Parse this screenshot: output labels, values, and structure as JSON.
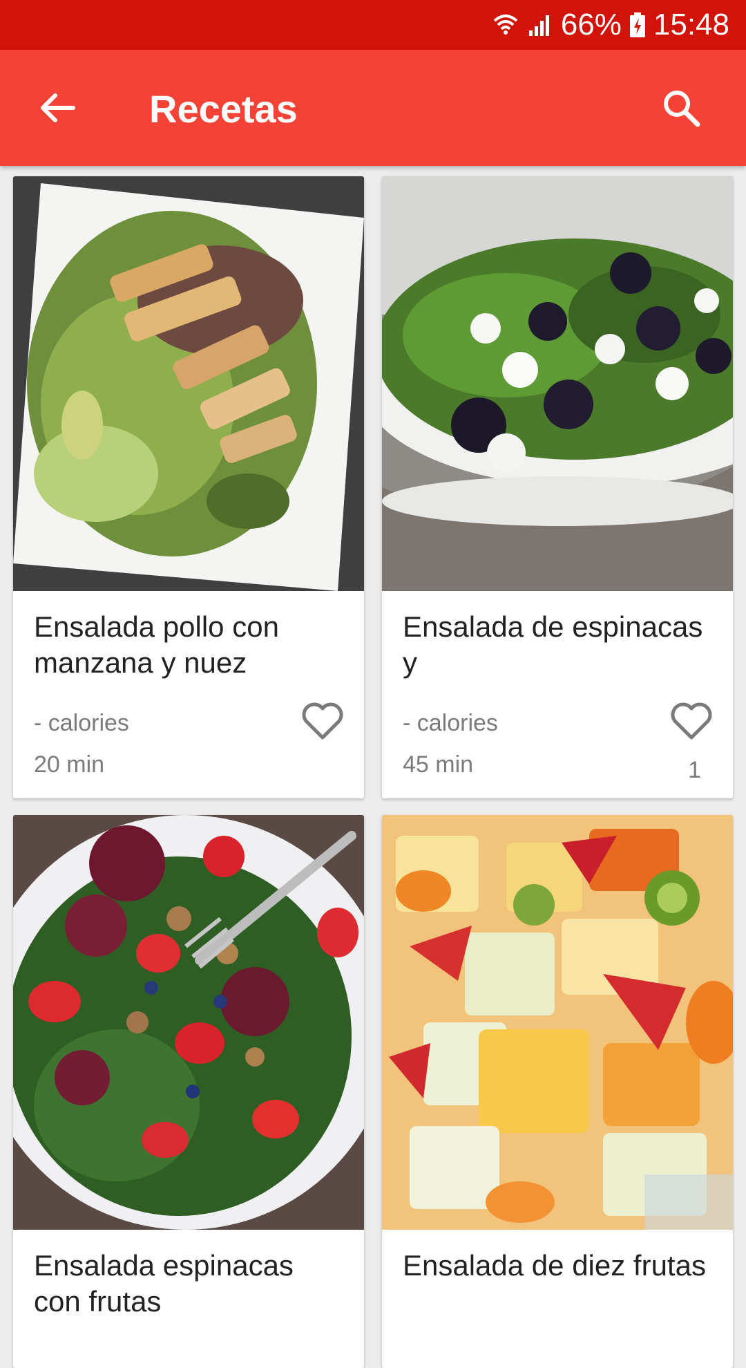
{
  "status_bar": {
    "battery": "66%",
    "time": "15:48",
    "icons": [
      "wifi-icon",
      "signal-icon",
      "battery-charging-icon"
    ]
  },
  "app_bar": {
    "title": "Recetas",
    "back_icon": "arrow-back-icon",
    "search_icon": "search-icon"
  },
  "colors": {
    "status_bar": "#d11407",
    "app_bar": "#f44336",
    "background": "#ececec"
  },
  "recipes": [
    {
      "name": "Ensalada pollo con manzana y nuez",
      "calories": "- calories",
      "time": "20 min",
      "likes": ""
    },
    {
      "name": "Ensalada de espinacas y",
      "calories": "- calories",
      "time": "45 min",
      "likes": "1"
    },
    {
      "name": "Ensalada espinacas con frutas",
      "calories": "",
      "time": "",
      "likes": ""
    },
    {
      "name": "Ensalada de diez frutas",
      "calories": "",
      "time": "",
      "likes": ""
    }
  ]
}
